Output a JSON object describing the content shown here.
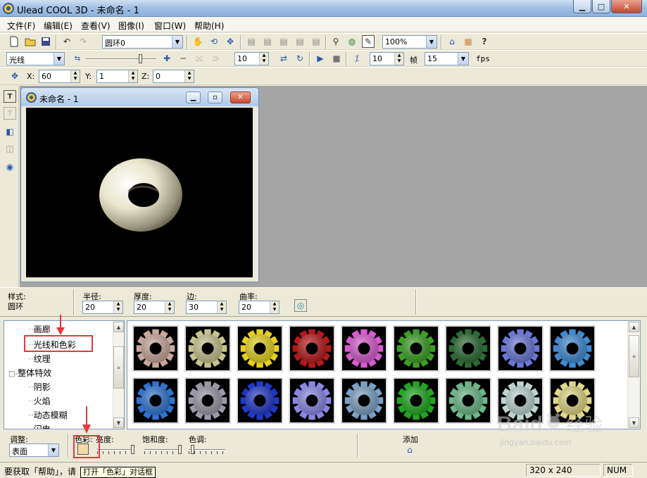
{
  "window": {
    "title": "Ulead COOL 3D - 未命名 - 1",
    "controls": {
      "minimize": "▁",
      "maximize": "□",
      "close": "✕"
    }
  },
  "menu": [
    "文件(F)",
    "编辑(E)",
    "查看(V)",
    "图像(I)",
    "窗口(W)",
    "帮助(H)"
  ],
  "toolbar1": {
    "object_select": "圆环0",
    "zoom_select": "100%",
    "help_icon": "?"
  },
  "toolbar2": {
    "category_select": "光线",
    "value1": "10",
    "frame_value": "10",
    "frame_label": "帧",
    "fps_value": "15",
    "fps_label": "fps"
  },
  "toolbar3": {
    "x_label": "X:",
    "x_value": "60",
    "y_label": "Y:",
    "y_value": "1",
    "z_label": "Z:",
    "z_value": "0"
  },
  "doc_window": {
    "title": "未命名 - 1"
  },
  "props": {
    "style_label": "样式:",
    "style_value": "圆环",
    "radius_label": "半径:",
    "radius_value": "20",
    "thickness_label": "厚度:",
    "thickness_value": "20",
    "edges_label": "边:",
    "edges_value": "30",
    "curvature_label": "曲率:",
    "curvature_value": "20"
  },
  "tree": {
    "items": [
      {
        "label": "画廊",
        "indent": 1
      },
      {
        "label": "光线和色彩",
        "indent": 1
      },
      {
        "label": "纹理",
        "indent": 1
      },
      {
        "label": "整体特效",
        "indent": 0,
        "expander": "□-"
      },
      {
        "label": "阴影",
        "indent": 1
      },
      {
        "label": "火焰",
        "indent": 1
      },
      {
        "label": "动态模糊",
        "indent": 1
      },
      {
        "label": "闪电",
        "indent": 1
      }
    ]
  },
  "thumbs": {
    "row1": [
      "#c9a79a",
      "#c6c48e",
      "#e6d21c",
      "#b81818",
      "#d85ad0",
      "#3aa024",
      "#2c6c34",
      "#6a78d8",
      "#3e8ad4"
    ],
    "row2": [
      "#2e74d4",
      "#9c98a8",
      "#1e38c8",
      "#8a86e6",
      "#7aa0c4",
      "#1ea81e",
      "#6ab888",
      "#bcd4d0",
      "#e0d884"
    ]
  },
  "adjust": {
    "adjust_label": "调整:",
    "adjust_value": "表面",
    "color_label": "色彩:",
    "brightness_label": "亮度:",
    "saturation_label": "饱和度:",
    "hue_label": "色调:",
    "add_label": "添加"
  },
  "status": {
    "help_text": "要获取「帮助」，请",
    "size": "320 x 240",
    "num": "NUM"
  },
  "tooltip": "打开「色彩」对话框",
  "watermark": {
    "brand": "Baid",
    "brand_cn": "经验",
    "url": "jingyan.baidu.com"
  },
  "colors": {
    "accent": "#e53a3a",
    "color_swatch": "#f7d9a8"
  }
}
